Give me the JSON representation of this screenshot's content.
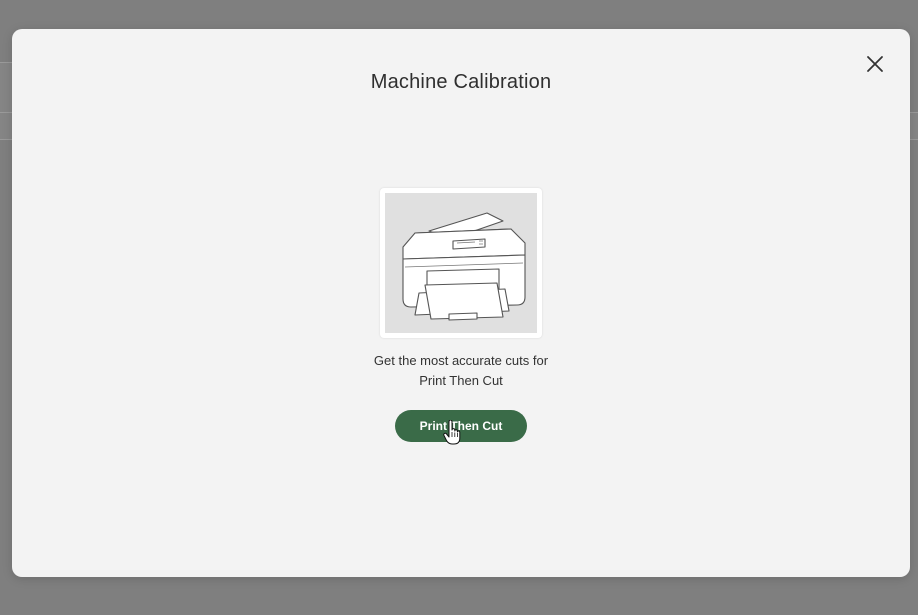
{
  "modal": {
    "title": "Machine Calibration",
    "close_icon": "close-icon",
    "illustration_icon": "printer-icon",
    "description_line1": "Get the most accurate cuts for",
    "description_line2": "Print Then Cut",
    "primary_button_label": "Print Then Cut",
    "cursor_icon": "hand-pointer-icon"
  },
  "colors": {
    "backdrop": "#7f7f7f",
    "modal_bg": "#f3f3f3",
    "accent": "#3a6b48",
    "illustration_bg": "#e0e0e0"
  }
}
